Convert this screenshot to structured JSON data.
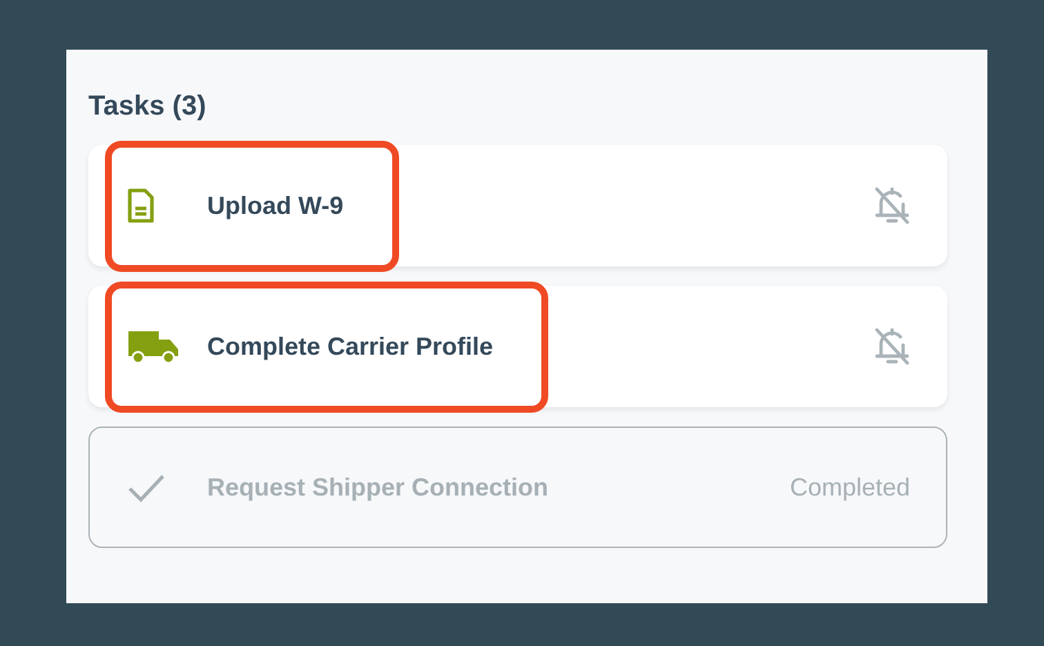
{
  "title": "Tasks (3)",
  "tasks": [
    {
      "kind": "document",
      "title": "Upload W-9",
      "completed": false,
      "highlighted": true
    },
    {
      "kind": "truck",
      "title": "Complete Carrier Profile",
      "completed": false,
      "highlighted": true
    },
    {
      "kind": "check",
      "title": "Request Shipper Connection",
      "completed": true,
      "highlighted": false,
      "status": "Completed"
    }
  ]
}
